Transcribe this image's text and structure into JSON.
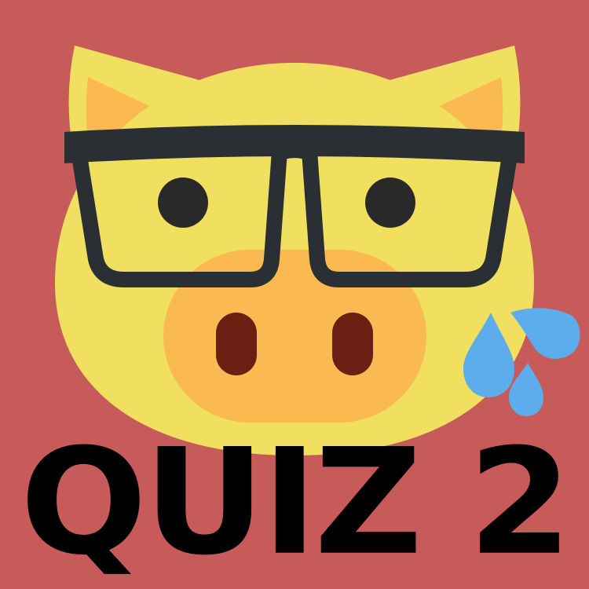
{
  "title": {
    "text": "QUIZ 2"
  },
  "illustration": {
    "subject": "pig-face-with-glasses-icon",
    "colors": {
      "background": "#c75b5a",
      "face": "#f1e05f",
      "ear_inner": "#fbb951",
      "snout": "#fbb951",
      "nostril": "#6b1e12",
      "eye": "#292929",
      "glasses": "#292f33",
      "sweat_drop": "#5dadec",
      "title_text": "#000000"
    }
  }
}
